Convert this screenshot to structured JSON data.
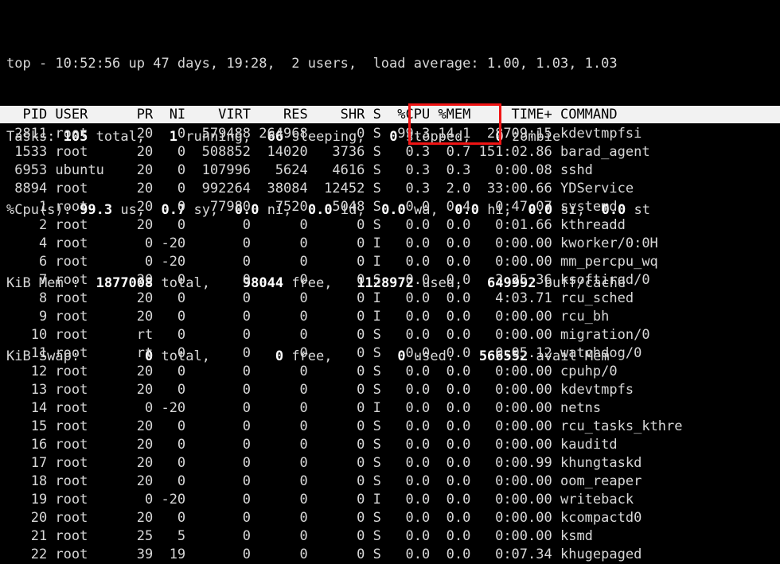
{
  "terminal": {
    "program": "top",
    "background_color": "#000000",
    "foreground_color": "#d8d8d8"
  },
  "summary": {
    "uptime_line": {
      "full": "top - 10:52:56 up 47 days, 19:28,  2 users,  load average: 1.00, 1.03, 1.03",
      "program": "top",
      "time": "10:52:56",
      "uptime": "47 days, 19:28",
      "users": "2 users",
      "load_average": [
        "1.00",
        "1.03",
        "1.03"
      ]
    },
    "tasks_line": {
      "label": "Tasks:",
      "total": "105",
      "total_label": "total,",
      "running": "1",
      "running_label": "running,",
      "sleeping": "66",
      "sleeping_label": "sleeping,",
      "stopped": "0",
      "stopped_label": "stopped,",
      "zombie": "0",
      "zombie_label": "zombie"
    },
    "cpu_line": {
      "label": "%Cpu(s):",
      "us": "99.3",
      "us_label": "us,",
      "sy": "0.7",
      "sy_label": "sy,",
      "ni": "0.0",
      "ni_label": "ni,",
      "id": "0.0",
      "id_label": "id,",
      "wa": "0.0",
      "wa_label": "wa,",
      "hi": "0.0",
      "hi_label": "hi,",
      "si": "0.0",
      "si_label": "si,",
      "st": "0.0",
      "st_label": "st"
    },
    "mem_line": {
      "label": "KiB Mem :",
      "total": "1877008",
      "total_label": "total,",
      "free": "98044",
      "free_label": "free,",
      "used": "1128972",
      "used_label": "used,",
      "buff_cache": "649992",
      "buff_cache_label": "buff/cache"
    },
    "swap_line": {
      "label": "KiB Swap:",
      "total": "0",
      "total_label": "total,",
      "free": "0",
      "free_label": "free,",
      "used": "0",
      "used_label": "used.",
      "avail": "566552",
      "avail_label": "avail Mem"
    }
  },
  "table": {
    "columns": [
      "PID",
      "USER",
      "PR",
      "NI",
      "VIRT",
      "RES",
      "SHR",
      "S",
      "%CPU",
      "%MEM",
      "TIME+",
      "COMMAND"
    ],
    "header_text": "  PID USER      PR  NI    VIRT    RES    SHR S  %CPU %MEM     TIME+ COMMAND",
    "rows": [
      {
        "pid": "2811",
        "user": "root",
        "pr": "20",
        "ni": "0",
        "virt": "579488",
        "res": "264968",
        "shr": "0",
        "s": "S",
        "cpu": "99.3",
        "mem": "14.1",
        "time": "28709:15",
        "command": "kdevtmpfsi"
      },
      {
        "pid": "1533",
        "user": "root",
        "pr": "20",
        "ni": "0",
        "virt": "508852",
        "res": "14020",
        "shr": "3736",
        "s": "S",
        "cpu": "0.3",
        "mem": "0.7",
        "time": "151:02.86",
        "command": "barad_agent"
      },
      {
        "pid": "6953",
        "user": "ubuntu",
        "pr": "20",
        "ni": "0",
        "virt": "107996",
        "res": "5624",
        "shr": "4616",
        "s": "S",
        "cpu": "0.3",
        "mem": "0.3",
        "time": "0:00.08",
        "command": "sshd"
      },
      {
        "pid": "8894",
        "user": "root",
        "pr": "20",
        "ni": "0",
        "virt": "992264",
        "res": "38084",
        "shr": "12452",
        "s": "S",
        "cpu": "0.3",
        "mem": "2.0",
        "time": "33:00.66",
        "command": "YDService"
      },
      {
        "pid": "1",
        "user": "root",
        "pr": "20",
        "ni": "0",
        "virt": "77980",
        "res": "7520",
        "shr": "5048",
        "s": "S",
        "cpu": "0.0",
        "mem": "0.4",
        "time": "0:47.07",
        "command": "systemd"
      },
      {
        "pid": "2",
        "user": "root",
        "pr": "20",
        "ni": "0",
        "virt": "0",
        "res": "0",
        "shr": "0",
        "s": "S",
        "cpu": "0.0",
        "mem": "0.0",
        "time": "0:01.66",
        "command": "kthreadd"
      },
      {
        "pid": "4",
        "user": "root",
        "pr": "0",
        "ni": "-20",
        "virt": "0",
        "res": "0",
        "shr": "0",
        "s": "I",
        "cpu": "0.0",
        "mem": "0.0",
        "time": "0:00.00",
        "command": "kworker/0:0H"
      },
      {
        "pid": "6",
        "user": "root",
        "pr": "0",
        "ni": "-20",
        "virt": "0",
        "res": "0",
        "shr": "0",
        "s": "I",
        "cpu": "0.0",
        "mem": "0.0",
        "time": "0:00.00",
        "command": "mm_percpu_wq"
      },
      {
        "pid": "7",
        "user": "root",
        "pr": "20",
        "ni": "0",
        "virt": "0",
        "res": "0",
        "shr": "0",
        "s": "S",
        "cpu": "0.0",
        "mem": "0.0",
        "time": "3:25.36",
        "command": "ksoftirqd/0"
      },
      {
        "pid": "8",
        "user": "root",
        "pr": "20",
        "ni": "0",
        "virt": "0",
        "res": "0",
        "shr": "0",
        "s": "I",
        "cpu": "0.0",
        "mem": "0.0",
        "time": "4:03.71",
        "command": "rcu_sched"
      },
      {
        "pid": "9",
        "user": "root",
        "pr": "20",
        "ni": "0",
        "virt": "0",
        "res": "0",
        "shr": "0",
        "s": "I",
        "cpu": "0.0",
        "mem": "0.0",
        "time": "0:00.00",
        "command": "rcu_bh"
      },
      {
        "pid": "10",
        "user": "root",
        "pr": "rt",
        "ni": "0",
        "virt": "0",
        "res": "0",
        "shr": "0",
        "s": "S",
        "cpu": "0.0",
        "mem": "0.0",
        "time": "0:00.00",
        "command": "migration/0"
      },
      {
        "pid": "11",
        "user": "root",
        "pr": "rt",
        "ni": "0",
        "virt": "0",
        "res": "0",
        "shr": "0",
        "s": "S",
        "cpu": "0.0",
        "mem": "0.0",
        "time": "0:05.12",
        "command": "watchdog/0"
      },
      {
        "pid": "12",
        "user": "root",
        "pr": "20",
        "ni": "0",
        "virt": "0",
        "res": "0",
        "shr": "0",
        "s": "S",
        "cpu": "0.0",
        "mem": "0.0",
        "time": "0:00.00",
        "command": "cpuhp/0"
      },
      {
        "pid": "13",
        "user": "root",
        "pr": "20",
        "ni": "0",
        "virt": "0",
        "res": "0",
        "shr": "0",
        "s": "S",
        "cpu": "0.0",
        "mem": "0.0",
        "time": "0:00.00",
        "command": "kdevtmpfs"
      },
      {
        "pid": "14",
        "user": "root",
        "pr": "0",
        "ni": "-20",
        "virt": "0",
        "res": "0",
        "shr": "0",
        "s": "I",
        "cpu": "0.0",
        "mem": "0.0",
        "time": "0:00.00",
        "command": "netns"
      },
      {
        "pid": "15",
        "user": "root",
        "pr": "20",
        "ni": "0",
        "virt": "0",
        "res": "0",
        "shr": "0",
        "s": "S",
        "cpu": "0.0",
        "mem": "0.0",
        "time": "0:00.00",
        "command": "rcu_tasks_kthre"
      },
      {
        "pid": "16",
        "user": "root",
        "pr": "20",
        "ni": "0",
        "virt": "0",
        "res": "0",
        "shr": "0",
        "s": "S",
        "cpu": "0.0",
        "mem": "0.0",
        "time": "0:00.00",
        "command": "kauditd"
      },
      {
        "pid": "17",
        "user": "root",
        "pr": "20",
        "ni": "0",
        "virt": "0",
        "res": "0",
        "shr": "0",
        "s": "S",
        "cpu": "0.0",
        "mem": "0.0",
        "time": "0:00.99",
        "command": "khungtaskd"
      },
      {
        "pid": "18",
        "user": "root",
        "pr": "20",
        "ni": "0",
        "virt": "0",
        "res": "0",
        "shr": "0",
        "s": "S",
        "cpu": "0.0",
        "mem": "0.0",
        "time": "0:00.00",
        "command": "oom_reaper"
      },
      {
        "pid": "19",
        "user": "root",
        "pr": "0",
        "ni": "-20",
        "virt": "0",
        "res": "0",
        "shr": "0",
        "s": "I",
        "cpu": "0.0",
        "mem": "0.0",
        "time": "0:00.00",
        "command": "writeback"
      },
      {
        "pid": "20",
        "user": "root",
        "pr": "20",
        "ni": "0",
        "virt": "0",
        "res": "0",
        "shr": "0",
        "s": "S",
        "cpu": "0.0",
        "mem": "0.0",
        "time": "0:00.00",
        "command": "kcompactd0"
      },
      {
        "pid": "21",
        "user": "root",
        "pr": "25",
        "ni": "5",
        "virt": "0",
        "res": "0",
        "shr": "0",
        "s": "S",
        "cpu": "0.0",
        "mem": "0.0",
        "time": "0:00.00",
        "command": "ksmd"
      },
      {
        "pid": "22",
        "user": "root",
        "pr": "39",
        "ni": "19",
        "virt": "0",
        "res": "0",
        "shr": "0",
        "s": "S",
        "cpu": "0.0",
        "mem": "0.0",
        "time": "0:07.34",
        "command": "khugepaged"
      }
    ]
  },
  "annotation": {
    "highlight_color": "#f01414",
    "highlight_target": "%CPU %MEM columns of top process kdevtmpfsi"
  }
}
